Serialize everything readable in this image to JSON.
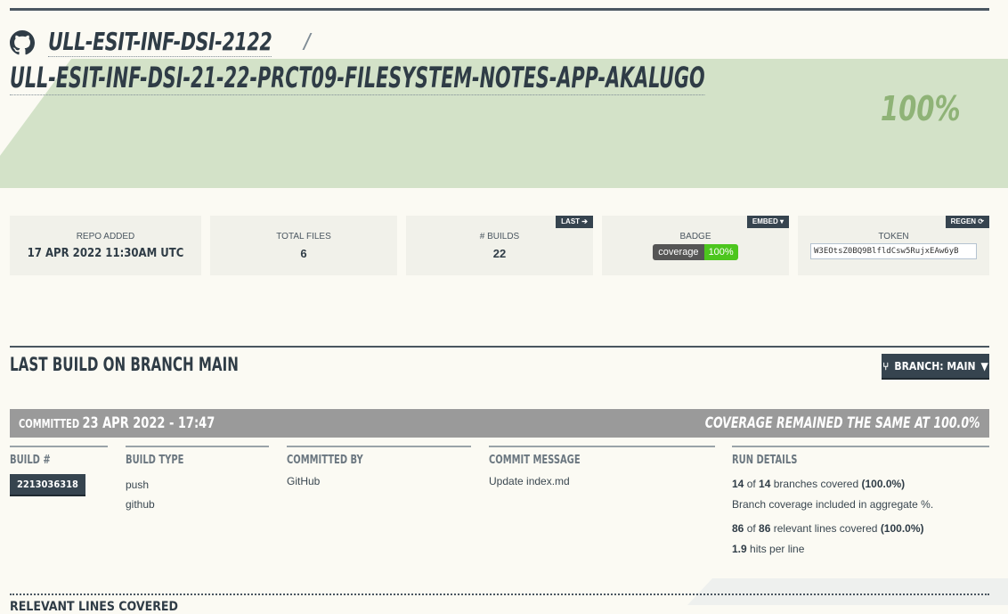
{
  "header": {
    "org": "ULL-ESIT-INF-DSI-2122",
    "separator": "/",
    "repo": "ULL-ESIT-INF-DSI-21-22-PRCT09-FILESYSTEM-NOTES-APP-AKALUGO",
    "coverage": "100%"
  },
  "cards": {
    "repo_added": {
      "label": "REPO ADDED",
      "value": "17 APR 2022 11:30AM UTC"
    },
    "total_files": {
      "label": "TOTAL FILES",
      "value": "6"
    },
    "builds": {
      "label": "# BUILDS",
      "value": "22",
      "tag": "LAST"
    },
    "badge": {
      "label": "BADGE",
      "tag": "EMBED ▾",
      "left": "coverage",
      "right": "100%"
    },
    "token": {
      "label": "TOKEN",
      "tag": "REGEN",
      "value": "W3EOtsZ0BQ9BlfldCsw5RujxEAw6yB"
    }
  },
  "last_build": {
    "title": "LAST BUILD ON BRANCH MAIN",
    "branch_button": "BRANCH: MAIN",
    "committed_label": "COMMITTED",
    "committed_at": "23 APR 2022 - 17:47",
    "coverage_note": "COVERAGE REMAINED THE SAME AT 100.0%"
  },
  "details": {
    "build_num": {
      "header": "BUILD #",
      "value": "2213036318"
    },
    "build_type": {
      "header": "BUILD TYPE",
      "lines": [
        "push",
        "github"
      ]
    },
    "committed_by": {
      "header": "COMMITTED BY",
      "value": "GitHub"
    },
    "commit_message": {
      "header": "COMMIT MESSAGE",
      "value": "Update index.md"
    },
    "run_details": {
      "header": "RUN DETAILS",
      "branches_covered": "14",
      "branches_total": "14",
      "branches_pct": "(100.0%)",
      "branch_note": "Branch coverage included in aggregate %.",
      "lines_covered": "86",
      "lines_total": "86",
      "lines_pct": "(100.0%)",
      "hits": "1.9"
    }
  },
  "bottom": {
    "title": "RELEVANT LINES COVERED"
  },
  "colors": {
    "dark": "#36444f",
    "green_band": "#d3e2c8",
    "pct": "#8fb377",
    "badge_green": "#4cc61e"
  }
}
